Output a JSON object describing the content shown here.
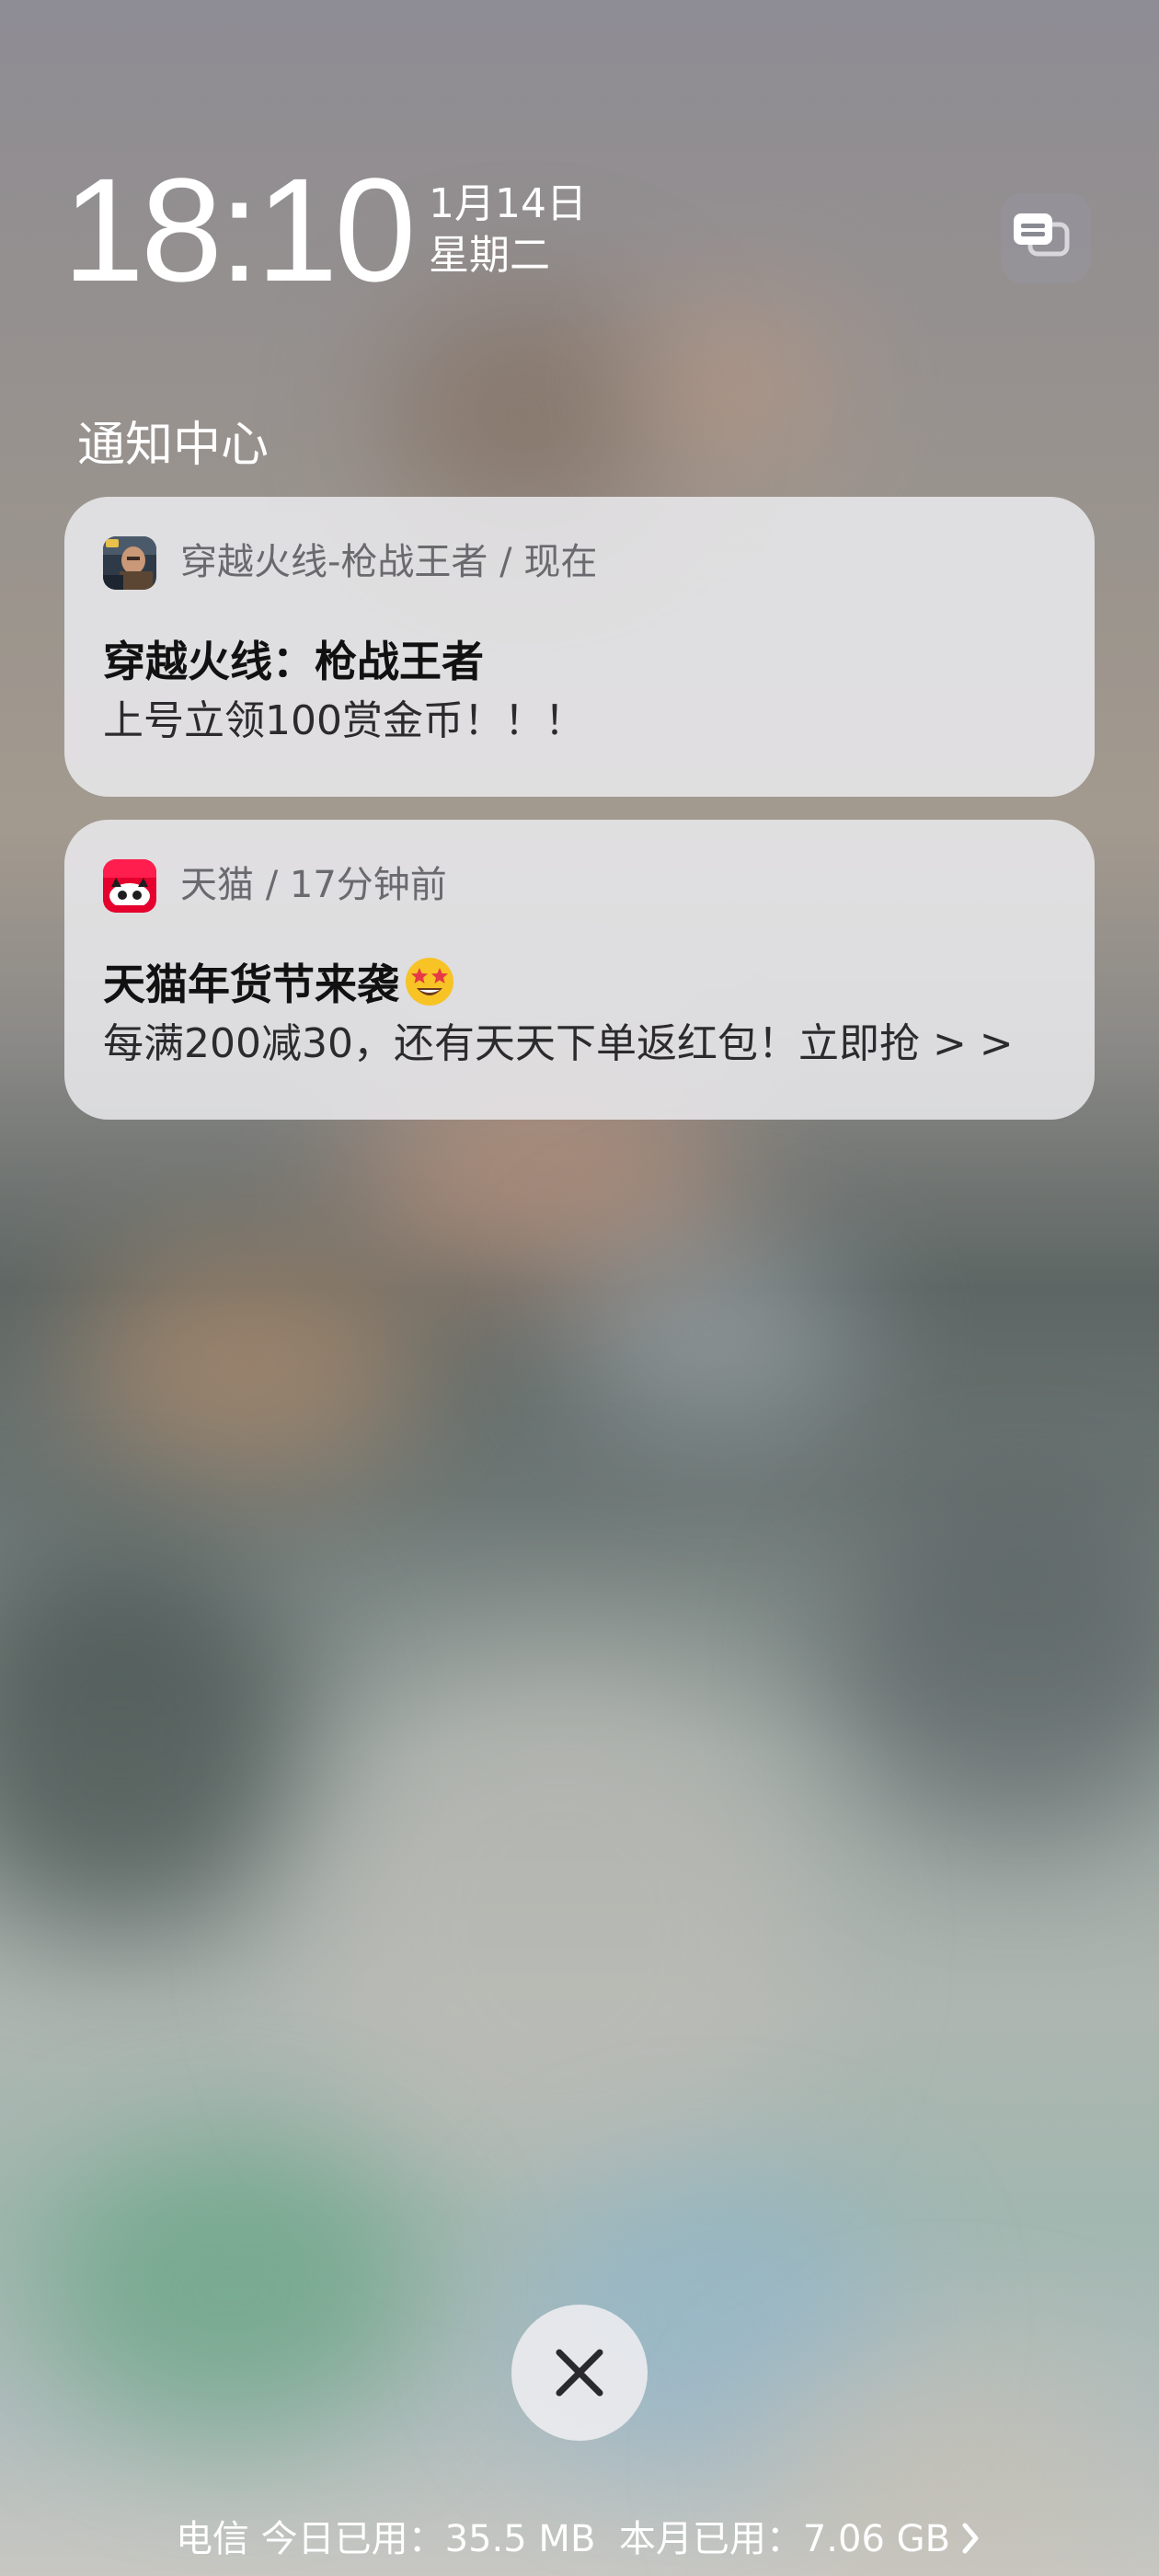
{
  "lock_screen": {
    "time": "18:10",
    "date": "1月14日",
    "weekday": "星期二",
    "grouping_icon": "notification-stack-icon"
  },
  "notification_center": {
    "title": "通知中心",
    "notifications": [
      {
        "app_icon": "crossfire-game-app-icon",
        "header": "穿越火线-枪战王者 / 现在",
        "title": "穿越火线：枪战王者",
        "body": "上号立领100赏金币！！！"
      },
      {
        "app_icon": "tmall-app-icon",
        "header": "天猫 / 17分钟前",
        "title": "天猫年货节来袭",
        "title_emoji": "star-struck-emoji",
        "body": "每满200减30，还有天天下单返红包！立即抢 > >"
      }
    ]
  },
  "controls": {
    "clear_icon": "close-icon"
  },
  "data_usage": {
    "carrier": "电信",
    "today_label": "今日已用：",
    "today_value": "35.5 MB",
    "month_label": "本月已用：",
    "month_value": "7.06 GB",
    "chevron_icon": "chevron-right-icon"
  },
  "colors": {
    "card_background": "#ececf0",
    "text_primary": "#111111",
    "text_secondary": "#6a6a6e",
    "tmall_red": "#e5002d"
  }
}
